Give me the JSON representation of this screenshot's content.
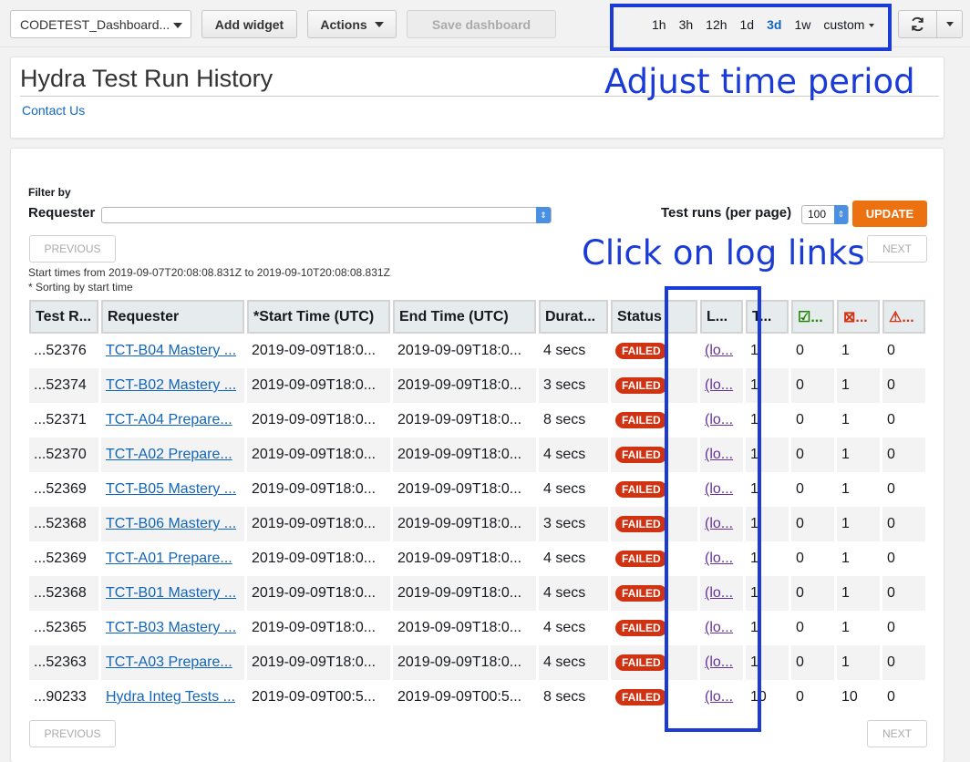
{
  "toolbar": {
    "dashboard_name": "CODETEST_Dashboard...",
    "add_widget": "Add widget",
    "actions": "Actions",
    "save_dashboard": "Save dashboard",
    "time_ranges": [
      "1h",
      "3h",
      "12h",
      "1d",
      "3d",
      "1w"
    ],
    "active_range": "3d",
    "custom": "custom"
  },
  "header": {
    "title": "Hydra Test Run History",
    "contact": "Contact Us"
  },
  "filters": {
    "filter_by": "Filter by",
    "requester_label": "Requester",
    "requester_value": "",
    "runs_label": "Test runs (per page)",
    "runs_value": "100",
    "update": "UPDATE"
  },
  "pager": {
    "previous": "PREVIOUS",
    "next": "NEXT"
  },
  "notes": {
    "start_times": "Start times from 2019-09-07T20:08:08.831Z to 2019-09-10T20:08:08.831Z",
    "sorting": "* Sorting by start time"
  },
  "table": {
    "columns": [
      "Test R...",
      "Requester",
      "*Start Time (UTC)",
      "End Time (UTC)",
      "Durat...",
      "Status",
      "L...",
      "T...",
      "☑...",
      "⊠...",
      "⚠..."
    ],
    "rows": [
      {
        "id": "...52376",
        "requester": "TCT-B04 Mastery ...",
        "start": "2019-09-09T18:0...",
        "end": "2019-09-09T18:0...",
        "duration": "4 secs",
        "status": "FAILED",
        "log": "(lo...",
        "total": "1",
        "passed": "0",
        "failed": "1",
        "warnings": "0"
      },
      {
        "id": "...52374",
        "requester": "TCT-B02 Mastery ...",
        "start": "2019-09-09T18:0...",
        "end": "2019-09-09T18:0...",
        "duration": "3 secs",
        "status": "FAILED",
        "log": "(lo...",
        "total": "1",
        "passed": "0",
        "failed": "1",
        "warnings": "0"
      },
      {
        "id": "...52371",
        "requester": "TCT-A04 Prepare...",
        "start": "2019-09-09T18:0...",
        "end": "2019-09-09T18:0...",
        "duration": "8 secs",
        "status": "FAILED",
        "log": "(lo...",
        "total": "1",
        "passed": "0",
        "failed": "1",
        "warnings": "0"
      },
      {
        "id": "...52370",
        "requester": "TCT-A02 Prepare...",
        "start": "2019-09-09T18:0...",
        "end": "2019-09-09T18:0...",
        "duration": "4 secs",
        "status": "FAILED",
        "log": "(lo...",
        "total": "1",
        "passed": "0",
        "failed": "1",
        "warnings": "0"
      },
      {
        "id": "...52369",
        "requester": "TCT-B05 Mastery ...",
        "start": "2019-09-09T18:0...",
        "end": "2019-09-09T18:0...",
        "duration": "4 secs",
        "status": "FAILED",
        "log": "(lo...",
        "total": "1",
        "passed": "0",
        "failed": "1",
        "warnings": "0"
      },
      {
        "id": "...52368",
        "requester": "TCT-B06 Mastery ...",
        "start": "2019-09-09T18:0...",
        "end": "2019-09-09T18:0...",
        "duration": "3 secs",
        "status": "FAILED",
        "log": "(lo...",
        "total": "1",
        "passed": "0",
        "failed": "1",
        "warnings": "0"
      },
      {
        "id": "...52369",
        "requester": "TCT-A01 Prepare...",
        "start": "2019-09-09T18:0...",
        "end": "2019-09-09T18:0...",
        "duration": "4 secs",
        "status": "FAILED",
        "log": "(lo...",
        "total": "1",
        "passed": "0",
        "failed": "1",
        "warnings": "0"
      },
      {
        "id": "...52368",
        "requester": "TCT-B01 Mastery ...",
        "start": "2019-09-09T18:0...",
        "end": "2019-09-09T18:0...",
        "duration": "4 secs",
        "status": "FAILED",
        "log": "(lo...",
        "total": "1",
        "passed": "0",
        "failed": "1",
        "warnings": "0"
      },
      {
        "id": "...52365",
        "requester": "TCT-B03 Mastery ...",
        "start": "2019-09-09T18:0...",
        "end": "2019-09-09T18:0...",
        "duration": "4 secs",
        "status": "FAILED",
        "log": "(lo...",
        "total": "1",
        "passed": "0",
        "failed": "1",
        "warnings": "0"
      },
      {
        "id": "...52363",
        "requester": "TCT-A03 Prepare...",
        "start": "2019-09-09T18:0...",
        "end": "2019-09-09T18:0...",
        "duration": "4 secs",
        "status": "FAILED",
        "log": "(lo...",
        "total": "1",
        "passed": "0",
        "failed": "1",
        "warnings": "0"
      },
      {
        "id": "...90233",
        "requester": "Hydra Integ Tests ...",
        "start": "2019-09-09T00:5...",
        "end": "2019-09-09T00:5...",
        "duration": "8 secs",
        "status": "FAILED",
        "log": "(lo...",
        "total": "10",
        "passed": "0",
        "failed": "10",
        "warnings": "0"
      }
    ]
  },
  "annotations": {
    "time_period": "Adjust time period",
    "log_links": "Click on log links"
  },
  "colors": {
    "accent_link": "#1166bb",
    "update_button": "#ec7211",
    "failed_badge": "#d13212",
    "annotation": "#1a3bd6"
  },
  "icons": {
    "refresh": "refresh-icon",
    "passed": "checkbox-checked-icon",
    "failed": "checkbox-cross-icon",
    "warning": "warning-triangle-icon"
  }
}
